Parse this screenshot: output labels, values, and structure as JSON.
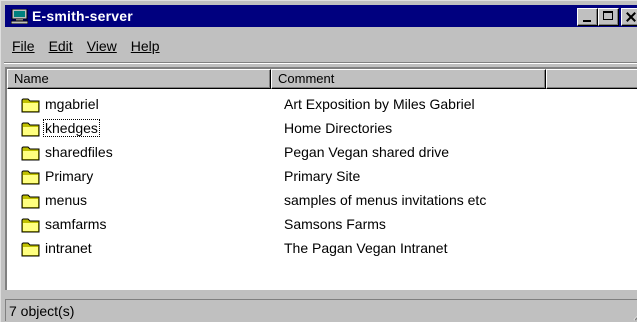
{
  "window": {
    "title": "E-smith-server"
  },
  "menu": [
    {
      "label": "File"
    },
    {
      "label": "Edit"
    },
    {
      "label": "View"
    },
    {
      "label": "Help"
    }
  ],
  "columns": {
    "name": "Name",
    "comment": "Comment",
    "extra": ""
  },
  "items": [
    {
      "name": "mgabriel",
      "comment": "Art Exposition by Miles Gabriel",
      "icon": "folder-icon"
    },
    {
      "name": "khedges",
      "comment": "Home Directories",
      "icon": "folder-icon",
      "focused": true
    },
    {
      "name": "sharedfiles",
      "comment": "Pegan Vegan shared drive",
      "icon": "folder-icon"
    },
    {
      "name": "Primary",
      "comment": "Primary Site",
      "icon": "folder-icon"
    },
    {
      "name": "menus",
      "comment": "samples of menus invitations etc",
      "icon": "folder-icon"
    },
    {
      "name": "samfarms",
      "comment": "Samsons Farms",
      "icon": "folder-icon"
    },
    {
      "name": "intranet",
      "comment": "The Pagan Vegan Intranet",
      "icon": "folder-icon"
    }
  ],
  "status": {
    "text": "7 object(s)"
  },
  "colors": {
    "titlebar": "#00007f",
    "face": "#c0c0c0",
    "folder": "#ffff80"
  }
}
